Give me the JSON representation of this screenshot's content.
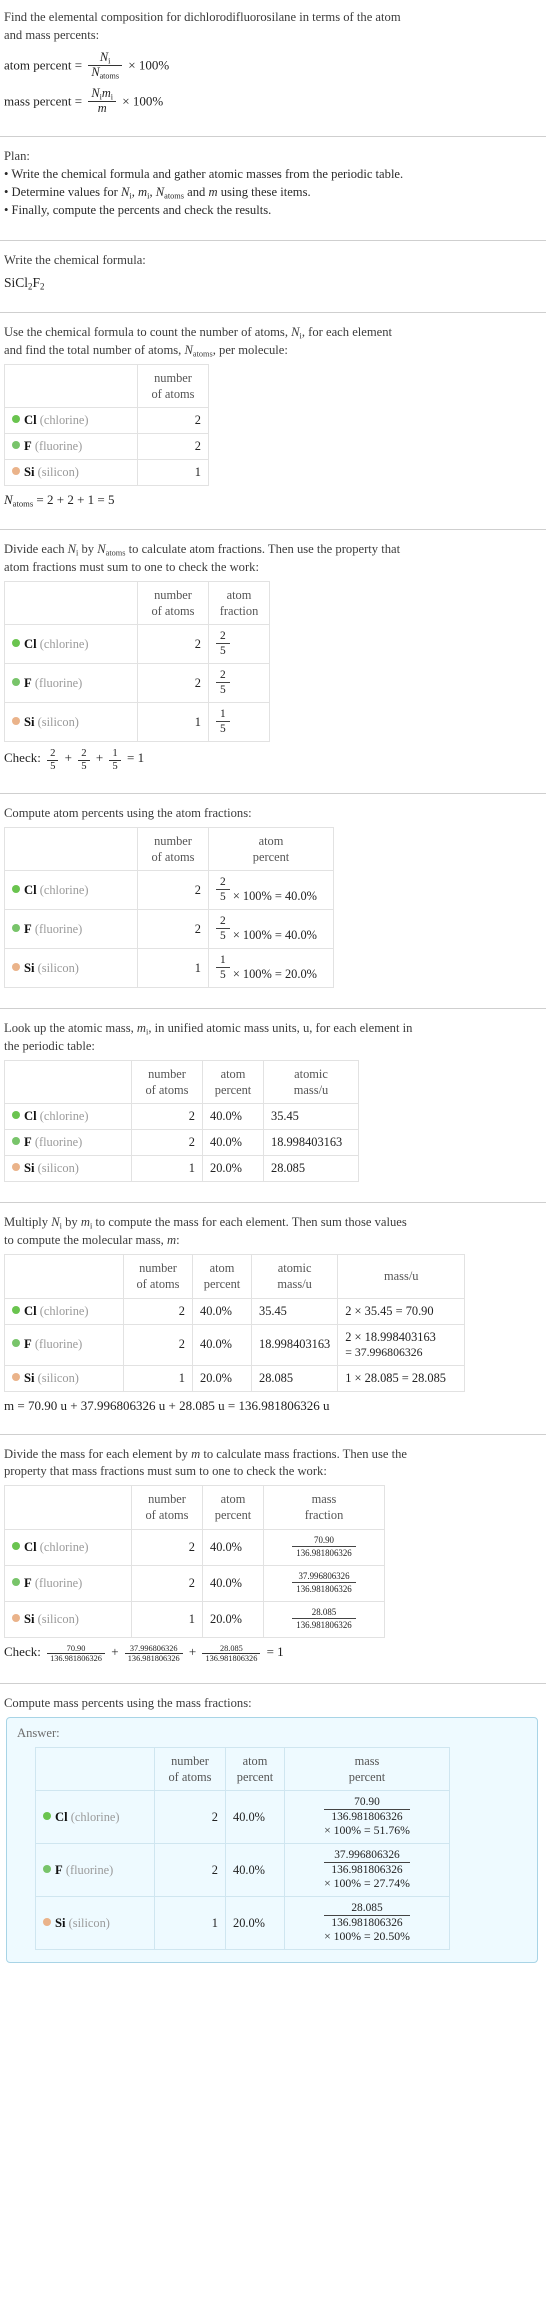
{
  "colors": {
    "chlorine": "#6ac44f",
    "fluorine": "#78c46a",
    "silicon": "#eab38a",
    "answer_bg": "#eefaff",
    "answer_border": "#a8d4e6"
  },
  "intro": {
    "line1": "Find the elemental composition for dichlorodifluorosilane in terms of the atom",
    "line2": "and mass percents:",
    "atom_percent_label": "atom percent =",
    "atom_percent_num": "N",
    "atom_percent_num_sub": "i",
    "atom_percent_den": "N",
    "atom_percent_den_sub": "atoms",
    "times100": "× 100%",
    "mass_percent_label": "mass percent =",
    "mass_percent_num": "N",
    "mass_percent_num_sub": "i",
    "mass_percent_num2": "m",
    "mass_percent_num2_sub": "i",
    "mass_percent_den": "m"
  },
  "plan": {
    "title": "Plan:",
    "bullets": [
      "• Write the chemical formula and gather atomic masses from the periodic table.",
      "• Determine values for Nᵢ, mᵢ, Nₐₜₒₘₛ and m using these items.",
      "• Finally, compute the percents and check the results."
    ],
    "bullet2_parts": {
      "pre": "• Determine values for ",
      "n": "N",
      "n_sub": "i",
      "comma1": ", ",
      "m": "m",
      "m_sub": "i",
      "comma2": ", ",
      "natoms": "N",
      "natoms_sub": "atoms",
      "and": " and ",
      "mm": "m",
      "post": " using these items."
    }
  },
  "formula_section": {
    "prompt": "Write the chemical formula:",
    "formula_parts": [
      {
        "text": "SiCl",
        "sub": "2"
      },
      {
        "text": "F",
        "sub": "2"
      }
    ]
  },
  "count_section": {
    "prompt_line1": "Use the chemical formula to count the number of atoms, Nᵢ, for each element",
    "prompt_line2": "and find the total number of atoms, Nₐₜₒₘₛ, per molecule:",
    "prompt_p1": "Use the chemical formula to count the number of atoms, ",
    "prompt_p2": ", for each element",
    "prompt_p3": "and find the total number of atoms, ",
    "prompt_p4": ", per molecule:",
    "header_number_of_atoms": [
      "number",
      "of atoms"
    ],
    "rows": [
      {
        "symbol": "Cl",
        "name": "(chlorine)",
        "color": "#6ac44f",
        "count": "2"
      },
      {
        "symbol": "F",
        "name": "(fluorine)",
        "color": "#78c46a",
        "count": "2"
      },
      {
        "symbol": "Si",
        "name": "(silicon)",
        "color": "#eab38a",
        "count": "1"
      }
    ],
    "total_line_prefix": "N",
    "total_line_sub": "atoms",
    "total_line_rest": "= 2 + 2 + 1 = 5"
  },
  "fraction_section": {
    "prompt_p1": "Divide each ",
    "prompt_p2": " by ",
    "prompt_p3": " to calculate atom fractions. Then use the property that",
    "prompt_line2": "atom fractions must sum to one to check the work:",
    "header_number_of_atoms": [
      "number",
      "of atoms"
    ],
    "header_atom_fraction": [
      "atom",
      "fraction"
    ],
    "rows": [
      {
        "symbol": "Cl",
        "name": "(chlorine)",
        "color": "#6ac44f",
        "count": "2",
        "frac_num": "2",
        "frac_den": "5"
      },
      {
        "symbol": "F",
        "name": "(fluorine)",
        "color": "#78c46a",
        "count": "2",
        "frac_num": "2",
        "frac_den": "5"
      },
      {
        "symbol": "Si",
        "name": "(silicon)",
        "color": "#eab38a",
        "count": "1",
        "frac_num": "1",
        "frac_den": "5"
      }
    ],
    "check_label": "Check:",
    "check_terms": [
      {
        "num": "2",
        "den": "5"
      },
      {
        "num": "2",
        "den": "5"
      },
      {
        "num": "1",
        "den": "5"
      }
    ],
    "check_result": "= 1"
  },
  "atom_percent_section": {
    "prompt": "Compute atom percents using the atom fractions:",
    "header_number_of_atoms": [
      "number",
      "of atoms"
    ],
    "header_atom_percent": [
      "atom",
      "percent"
    ],
    "rows": [
      {
        "symbol": "Cl",
        "name": "(chlorine)",
        "color": "#6ac44f",
        "count": "2",
        "frac_num": "2",
        "frac_den": "5",
        "expr": "× 100% = 40.0%"
      },
      {
        "symbol": "F",
        "name": "(fluorine)",
        "color": "#78c46a",
        "count": "2",
        "frac_num": "2",
        "frac_den": "5",
        "expr": "× 100% = 40.0%"
      },
      {
        "symbol": "Si",
        "name": "(silicon)",
        "color": "#eab38a",
        "count": "1",
        "frac_num": "1",
        "frac_den": "5",
        "expr": "× 100% = 20.0%"
      }
    ]
  },
  "atomic_mass_section": {
    "prompt_p1": "Look up the atomic mass, ",
    "prompt_p2": ", in unified atomic mass units, u, for each element in",
    "prompt_line2": "the periodic table:",
    "header_number_of_atoms": [
      "number",
      "of atoms"
    ],
    "header_atom_percent": [
      "atom",
      "percent"
    ],
    "header_atomic_mass": [
      "atomic",
      "mass/u"
    ],
    "rows": [
      {
        "symbol": "Cl",
        "name": "(chlorine)",
        "color": "#6ac44f",
        "count": "2",
        "atom_percent": "40.0%",
        "mass": "35.45"
      },
      {
        "symbol": "F",
        "name": "(fluorine)",
        "color": "#78c46a",
        "count": "2",
        "atom_percent": "40.0%",
        "mass": "18.998403163"
      },
      {
        "symbol": "Si",
        "name": "(silicon)",
        "color": "#eab38a",
        "count": "1",
        "atom_percent": "20.0%",
        "mass": "28.085"
      }
    ]
  },
  "mass_section": {
    "prompt_p1": "Multiply ",
    "prompt_p2": " by ",
    "prompt_p3": " to compute the mass for each element. Then sum those values",
    "prompt_line2_p1": "to compute the molecular mass, ",
    "prompt_line2_p2": ":",
    "header_number_of_atoms": [
      "number",
      "of atoms"
    ],
    "header_atom_percent": [
      "atom",
      "percent"
    ],
    "header_atomic_mass": [
      "atomic",
      "mass/u"
    ],
    "header_mass": "mass/u",
    "rows": [
      {
        "symbol": "Cl",
        "name": "(chlorine)",
        "color": "#6ac44f",
        "count": "2",
        "atom_percent": "40.0%",
        "mass": "35.45",
        "product": "2 × 35.45 = 70.90",
        "product2": ""
      },
      {
        "symbol": "F",
        "name": "(fluorine)",
        "color": "#78c46a",
        "count": "2",
        "atom_percent": "40.0%",
        "mass": "18.998403163",
        "product": "2 × 18.998403163",
        "product2": "= 37.996806326"
      },
      {
        "symbol": "Si",
        "name": "(silicon)",
        "color": "#eab38a",
        "count": "1",
        "atom_percent": "20.0%",
        "mass": "28.085",
        "product": "1 × 28.085 = 28.085",
        "product2": ""
      }
    ],
    "total_line": "m = 70.90 u + 37.996806326 u + 28.085 u = 136.981806326 u"
  },
  "mass_fraction_section": {
    "prompt_line1": "Divide the mass for each element by m to calculate mass fractions. Then use the",
    "prompt_line1_p1": "Divide the mass for each element by ",
    "prompt_line1_p2": " to calculate mass fractions. Then use the",
    "prompt_line2": "property that mass fractions must sum to one to check the work:",
    "header_number_of_atoms": [
      "number",
      "of atoms"
    ],
    "header_atom_percent": [
      "atom",
      "percent"
    ],
    "header_mass_fraction": [
      "mass",
      "fraction"
    ],
    "rows": [
      {
        "symbol": "Cl",
        "name": "(chlorine)",
        "color": "#6ac44f",
        "count": "2",
        "atom_percent": "40.0%",
        "frac_num": "70.90",
        "frac_den": "136.981806326"
      },
      {
        "symbol": "F",
        "name": "(fluorine)",
        "color": "#78c46a",
        "count": "2",
        "atom_percent": "40.0%",
        "frac_num": "37.996806326",
        "frac_den": "136.981806326"
      },
      {
        "symbol": "Si",
        "name": "(silicon)",
        "color": "#eab38a",
        "count": "1",
        "atom_percent": "20.0%",
        "frac_num": "28.085",
        "frac_den": "136.981806326"
      }
    ],
    "check_label": "Check:",
    "check_terms": [
      {
        "num": "70.90",
        "den": "136.981806326"
      },
      {
        "num": "37.996806326",
        "den": "136.981806326"
      },
      {
        "num": "28.085",
        "den": "136.981806326"
      }
    ],
    "check_result": "= 1"
  },
  "mass_percent_section": {
    "prompt": "Compute mass percents using the mass fractions:",
    "answer_label": "Answer:",
    "header_number_of_atoms": [
      "number",
      "of atoms"
    ],
    "header_atom_percent": [
      "atom",
      "percent"
    ],
    "header_mass_percent": [
      "mass",
      "percent"
    ],
    "rows": [
      {
        "symbol": "Cl",
        "name": "(chlorine)",
        "color": "#6ac44f",
        "count": "2",
        "atom_percent": "40.0%",
        "frac_num": "70.90",
        "frac_den": "136.981806326",
        "result": "× 100% = 51.76%"
      },
      {
        "symbol": "F",
        "name": "(fluorine)",
        "color": "#78c46a",
        "count": "2",
        "atom_percent": "40.0%",
        "frac_num": "37.996806326",
        "frac_den": "136.981806326",
        "result": "× 100% = 27.74%"
      },
      {
        "symbol": "Si",
        "name": "(silicon)",
        "color": "#eab38a",
        "count": "1",
        "atom_percent": "20.0%",
        "frac_num": "28.085",
        "frac_den": "136.981806326",
        "result": "× 100% = 20.50%"
      }
    ]
  }
}
